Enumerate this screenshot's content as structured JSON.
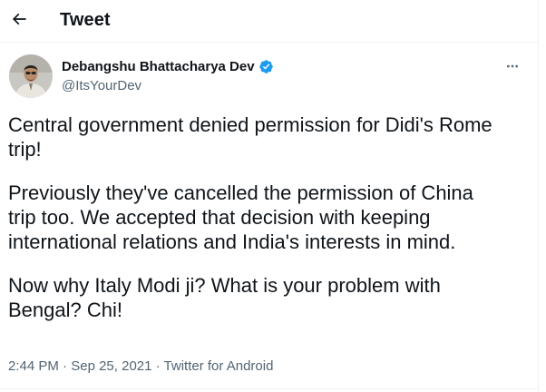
{
  "header": {
    "title": "Tweet",
    "back_icon": "arrow-left-icon"
  },
  "author": {
    "name": "Debangshu Bhattacharya Dev",
    "handle": "@ItsYourDev",
    "verified": true,
    "verified_icon": "verified-badge-icon",
    "verified_color": "#1d9bf0"
  },
  "more_icon": "more-horizontal-icon",
  "tweet": {
    "paragraphs": [
      "Central government denied permission for Didi's Rome\ntrip!",
      "Previously they've cancelled the permission of China\ntrip too. We accepted that decision with keeping\ninternational relations and India's interests  in mind.",
      "Now why Italy Modi ji? What is your problem with\nBengal? Chi!"
    ]
  },
  "meta": {
    "time": "2:44 PM",
    "date": "Sep 25, 2021",
    "separator": "·",
    "source": "Twitter for Android"
  },
  "colors": {
    "text": "#0f1419",
    "secondary": "#536471",
    "divider": "#eff3f4"
  }
}
